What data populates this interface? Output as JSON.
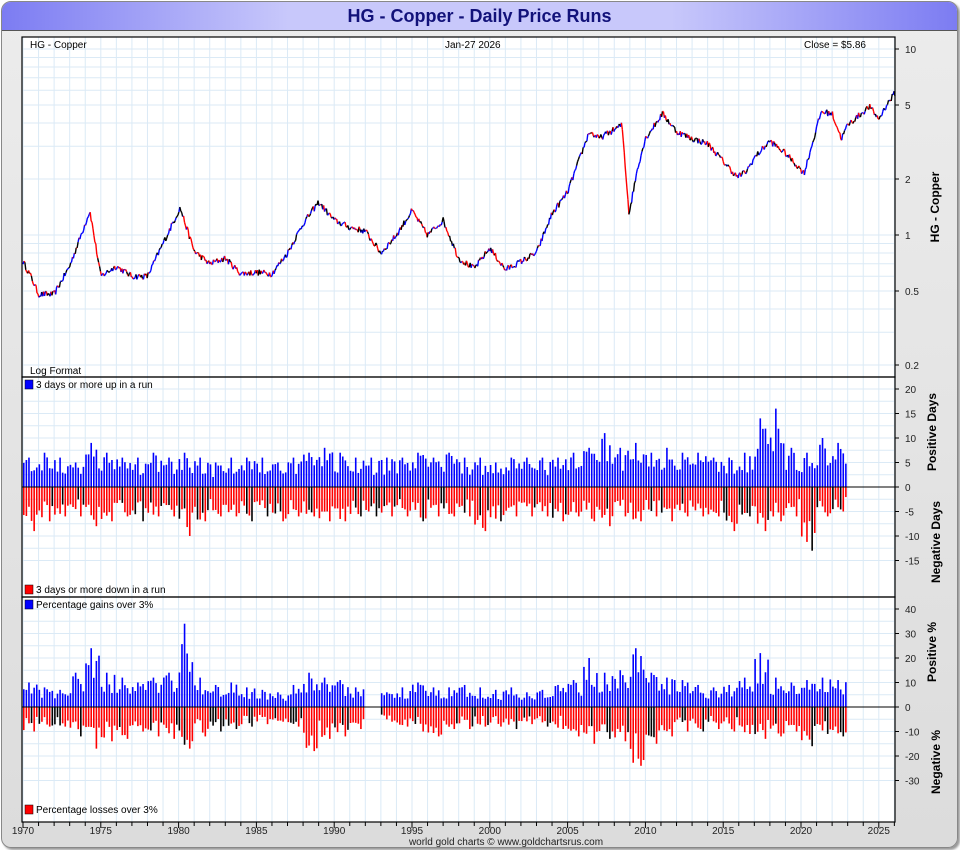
{
  "title": "HG  -  Copper - Daily Price Runs",
  "credit": "world gold charts © www.goldchartsrus.com",
  "chart_data": [
    {
      "type": "line",
      "name": "price",
      "label_left": "HG  -  Copper",
      "label_center": "Jan-27  2026",
      "label_right": "Close = $5.86",
      "format_label": "Log Format",
      "ylabel": "HG  -  Copper",
      "scale": "log",
      "ylim": [
        0.17,
        12
      ],
      "yticks": [
        "10",
        "5",
        "2",
        "1",
        "0.5",
        "0.2"
      ],
      "ytick_values": [
        10,
        5,
        2,
        1,
        0.5,
        0.2
      ],
      "points": [
        [
          1970,
          0.72
        ],
        [
          1970.5,
          0.6
        ],
        [
          1971,
          0.48
        ],
        [
          1972,
          0.48
        ],
        [
          1973,
          0.68
        ],
        [
          1974.3,
          1.35
        ],
        [
          1975,
          0.6
        ],
        [
          1976,
          0.68
        ],
        [
          1977,
          0.6
        ],
        [
          1978,
          0.6
        ],
        [
          1979,
          0.9
        ],
        [
          1980.1,
          1.4
        ],
        [
          1981,
          0.82
        ],
        [
          1982,
          0.7
        ],
        [
          1983,
          0.75
        ],
        [
          1984,
          0.62
        ],
        [
          1985,
          0.63
        ],
        [
          1986,
          0.62
        ],
        [
          1987,
          0.8
        ],
        [
          1988,
          1.15
        ],
        [
          1989,
          1.5
        ],
        [
          1990,
          1.2
        ],
        [
          1991,
          1.1
        ],
        [
          1992,
          1.05
        ],
        [
          1993,
          0.8
        ],
        [
          1994,
          1.0
        ],
        [
          1995,
          1.35
        ],
        [
          1996,
          1.0
        ],
        [
          1997,
          1.2
        ],
        [
          1998,
          0.75
        ],
        [
          1999,
          0.66
        ],
        [
          2000,
          0.85
        ],
        [
          2001,
          0.65
        ],
        [
          2002,
          0.72
        ],
        [
          2003,
          0.8
        ],
        [
          2004,
          1.3
        ],
        [
          2005,
          1.7
        ],
        [
          2006.4,
          3.6
        ],
        [
          2007,
          3.3
        ],
        [
          2008.5,
          3.9
        ],
        [
          2008.95,
          1.3
        ],
        [
          2009.5,
          2.3
        ],
        [
          2010,
          3.3
        ],
        [
          2011.1,
          4.5
        ],
        [
          2012,
          3.6
        ],
        [
          2013,
          3.3
        ],
        [
          2014,
          3.1
        ],
        [
          2015.9,
          2.05
        ],
        [
          2016.5,
          2.2
        ],
        [
          2017,
          2.6
        ],
        [
          2018,
          3.2
        ],
        [
          2019,
          2.75
        ],
        [
          2020.2,
          2.15
        ],
        [
          2021.3,
          4.6
        ],
        [
          2022,
          4.5
        ],
        [
          2022.6,
          3.3
        ],
        [
          2023,
          3.9
        ],
        [
          2024.4,
          4.9
        ],
        [
          2025,
          4.2
        ],
        [
          2025.5,
          5.0
        ],
        [
          2026.07,
          5.86
        ]
      ]
    },
    {
      "type": "bar",
      "name": "run_days",
      "legend_pos": "3 days or more up in a run",
      "legend_neg": "3 days or more down in a run",
      "ylabel_pos": "Positive Days",
      "ylabel_neg": "Negative Days",
      "ylim": [
        -17,
        22
      ],
      "yticks": [
        "20",
        "15",
        "10",
        "5",
        "0",
        "-5",
        "-10",
        "-15"
      ],
      "ytick_values": [
        20,
        15,
        10,
        5,
        0,
        -5,
        -10,
        -15
      ],
      "years": [
        1970,
        2022
      ],
      "annual_max_pos": [
        6,
        7,
        6,
        5,
        9,
        7,
        6,
        6,
        7,
        6,
        7,
        6,
        5,
        6,
        6,
        6,
        5,
        6,
        7,
        8,
        7,
        6,
        6,
        6,
        6,
        7,
        6,
        7,
        6,
        6,
        5,
        6,
        6,
        6,
        6,
        7,
        8,
        11,
        8,
        9,
        7,
        8,
        7,
        7,
        6,
        6,
        7,
        14,
        16,
        8,
        7,
        10,
        9
      ],
      "annual_max_neg": [
        -9,
        -7,
        -6,
        -6,
        -8,
        -7,
        -6,
        -7,
        -6,
        -6,
        -10,
        -7,
        -6,
        -6,
        -7,
        -6,
        -7,
        -6,
        -6,
        -7,
        -7,
        -6,
        -6,
        -6,
        -6,
        -7,
        -6,
        -6,
        -6,
        -9,
        -7,
        -6,
        -6,
        -6,
        -7,
        -6,
        -7,
        -8,
        -6,
        -7,
        -6,
        -7,
        -6,
        -6,
        -6,
        -9,
        -6,
        -9,
        -7,
        -6,
        -13,
        -6,
        -5
      ]
    },
    {
      "type": "bar",
      "name": "percent_moves",
      "legend_pos": "Percentage gains over 3%",
      "legend_neg": "Percentage losses over 3%",
      "ylabel_pos": "Positive %",
      "ylabel_neg": "Negative %",
      "ylim": [
        -33,
        41
      ],
      "yticks": [
        "40",
        "30",
        "20",
        "10",
        "0",
        "-10",
        "-20",
        "-30"
      ],
      "ytick_values": [
        40,
        30,
        20,
        10,
        0,
        -10,
        -20,
        -30
      ],
      "years": [
        1970,
        2022
      ],
      "annual_max_pos": [
        10,
        8,
        7,
        14,
        24,
        14,
        12,
        10,
        12,
        14,
        34,
        12,
        9,
        10,
        8,
        7,
        6,
        9,
        14,
        12,
        11,
        8,
        0,
        6,
        8,
        10,
        8,
        8,
        9,
        8,
        7,
        8,
        6,
        7,
        9,
        11,
        20,
        14,
        15,
        24,
        14,
        12,
        11,
        9,
        8,
        9,
        12,
        22,
        12,
        10,
        11,
        12,
        11
      ],
      "annual_max_neg": [
        -10,
        -8,
        -8,
        -12,
        -17,
        -14,
        -13,
        -10,
        -12,
        -13,
        -17,
        -12,
        -10,
        -9,
        -8,
        -7,
        -6,
        -8,
        -18,
        -13,
        -12,
        -9,
        0,
        -6,
        -8,
        -10,
        -12,
        -9,
        -9,
        -8,
        -8,
        -9,
        -7,
        -8,
        -9,
        -12,
        -15,
        -13,
        -14,
        -24,
        -15,
        -12,
        -10,
        -10,
        -9,
        -10,
        -11,
        -13,
        -12,
        -10,
        -16,
        -11,
        -12
      ]
    }
  ],
  "xaxis": {
    "ticks": [
      "1970",
      "1975",
      "1980",
      "1985",
      "1990",
      "1995",
      "2000",
      "2005",
      "2010",
      "2015",
      "2020",
      "2025"
    ],
    "tick_values": [
      1970,
      1975,
      1980,
      1985,
      1990,
      1995,
      2000,
      2005,
      2010,
      2015,
      2020,
      2025
    ]
  },
  "colors": {
    "up": "#0000ff",
    "down": "#ff0000",
    "grid": "#dbeaf6",
    "title": "#12127a"
  }
}
